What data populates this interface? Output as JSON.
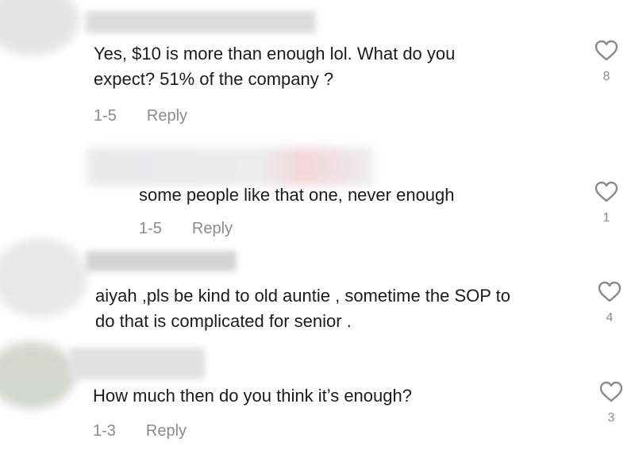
{
  "comments": [
    {
      "text_lines": [
        "Yes, $10 is more than enough lol. What do you",
        "expect? 51% of the company ?"
      ],
      "date": "1-5",
      "reply_label": "Reply",
      "likes": "8"
    },
    {
      "text_lines": [
        "some people like that one, never enough"
      ],
      "date": "1-5",
      "reply_label": "Reply",
      "likes": "1"
    },
    {
      "text_lines": [
        "aiyah ,pls be kind to old auntie , sometime the SOP to",
        "do that is complicated for senior ."
      ],
      "likes": "4"
    },
    {
      "text_lines": [
        "How much then do you think it’s enough?"
      ],
      "date": "1-3",
      "reply_label": "Reply",
      "likes": "3"
    }
  ],
  "icons": {
    "like": "heart-outline-icon"
  },
  "colors": {
    "text": "#1b1b1f",
    "muted": "#8a8b91",
    "background": "#ffffff"
  }
}
